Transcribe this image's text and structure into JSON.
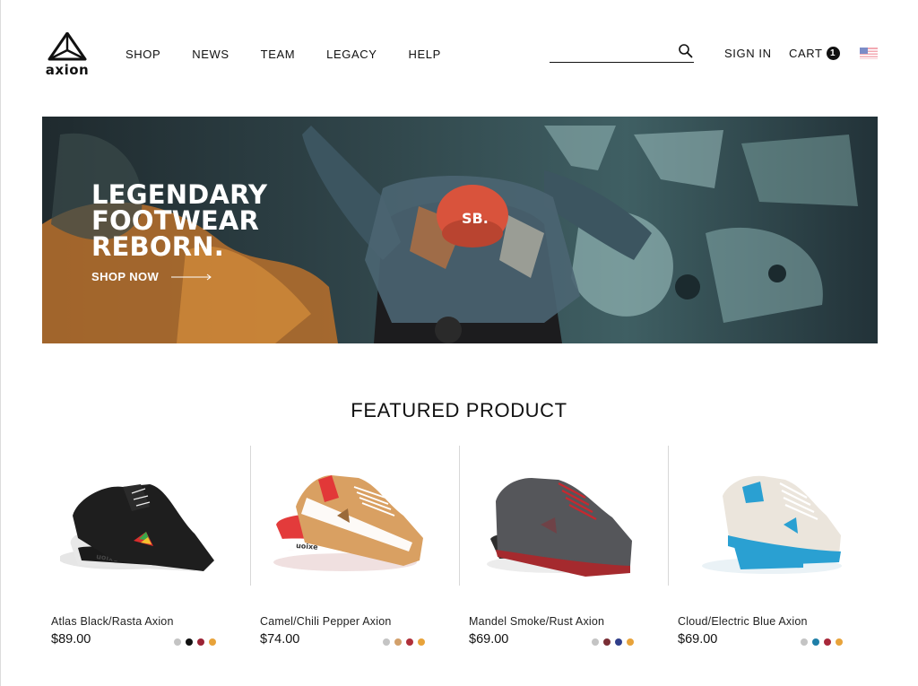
{
  "brand": {
    "name": "axion"
  },
  "nav": {
    "items": [
      "SHOP",
      "NEWS",
      "TEAM",
      "LEGACY",
      "HELP"
    ]
  },
  "search": {
    "value": "",
    "placeholder": ""
  },
  "account": {
    "sign_in": "SIGN IN",
    "cart_label": "CART",
    "cart_count": "1"
  },
  "hero": {
    "title_lines": [
      "LEGENDARY",
      "FOOTWEAR",
      "REBORN."
    ],
    "cta": "SHOP NOW",
    "cap_text": "SB."
  },
  "featured": {
    "title": "FEATURED PRODUCT",
    "products": [
      {
        "name": "Atlas Black/Rasta Axion",
        "price": "$89.00",
        "swatches": [
          "#c4c4c4",
          "#111111",
          "#9b2335",
          "#e8a33a"
        ]
      },
      {
        "name": "Camel/Chili Pepper Axion",
        "price": "$74.00",
        "swatches": [
          "#c4c4c4",
          "#d2a06b",
          "#b0303a",
          "#e8a33a"
        ]
      },
      {
        "name": "Mandel Smoke/Rust Axion",
        "price": "$69.00",
        "swatches": [
          "#c4c4c4",
          "#7a2e35",
          "#2f3e8a",
          "#e8a33a"
        ]
      },
      {
        "name": "Cloud/Electric Blue Axion",
        "price": "$69.00",
        "swatches": [
          "#c4c4c4",
          "#1f7fa8",
          "#a8283a",
          "#e8a33a"
        ]
      }
    ]
  },
  "colors": {
    "accent": "#111111",
    "hero_cap": "#d9533c"
  }
}
